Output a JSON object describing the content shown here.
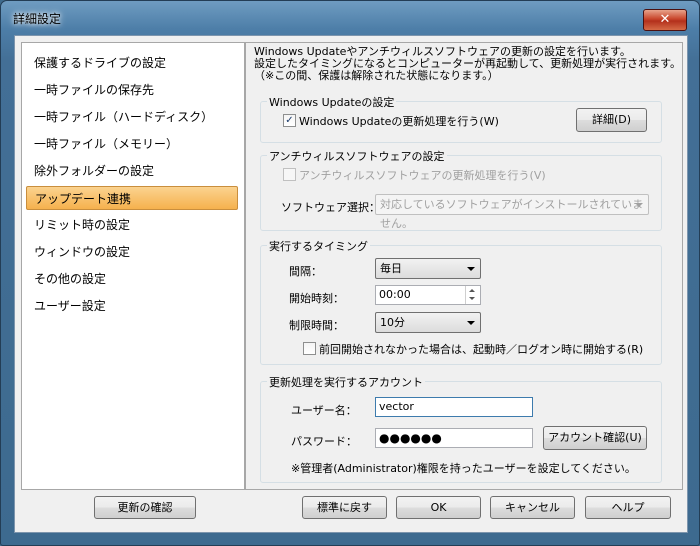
{
  "window": {
    "title": "詳細設定",
    "close_glyph": "✕"
  },
  "sidebar": {
    "items": [
      {
        "label": "保護するドライブの設定"
      },
      {
        "label": "一時ファイルの保存先"
      },
      {
        "label": "一時ファイル（ハードディスク）"
      },
      {
        "label": "一時ファイル（メモリー）"
      },
      {
        "label": "除外フォルダーの設定"
      },
      {
        "label": "アップデート連携",
        "selected": true
      },
      {
        "label": "リミット時の設定"
      },
      {
        "label": "ウィンドウの設定"
      },
      {
        "label": "その他の設定"
      },
      {
        "label": "ユーザー設定"
      }
    ]
  },
  "main": {
    "description": [
      "Windows Updateやアンチウィルスソフトウェアの更新の設定を行います。",
      "設定したタイミングになるとコンピューターが再起動して、更新処理が実行されます。",
      "（※この間、保護は解除された状態になります。）"
    ],
    "windows_update": {
      "group_label": "Windows Updateの設定",
      "checkbox_label": "Windows Updateの更新処理を行う(W)",
      "checked": true,
      "check_glyph": "✓",
      "details_button": "詳細(D)"
    },
    "antivirus": {
      "group_label": "アンチウィルスソフトウェアの設定",
      "checkbox_label": "アンチウィルスソフトウェアの更新処理を行う(V)",
      "checked": false,
      "software_label": "ソフトウェア選択：",
      "software_value": "対応しているソフトウェアがインストールされていません。"
    },
    "timing": {
      "group_label": "実行するタイミング",
      "interval_label": "間隔：",
      "interval_value": "毎日",
      "start_label": "開始時刻：",
      "start_value": "00:00",
      "limit_label": "制限時間：",
      "limit_value": "10分",
      "retry_label": "前回開始されなかった場合は、起動時／ログオン時に開始する(R)",
      "retry_checked": false
    },
    "account": {
      "group_label": "更新処理を実行するアカウント",
      "username_label": "ユーザー名：",
      "username_value": "vector",
      "password_label": "パスワード：",
      "password_value": "●●●●●●",
      "confirm_button": "アカウント確認(U)",
      "note": "※管理者(Administrator)権限を持ったユーザーを設定してください。"
    }
  },
  "footer": {
    "check_updates": "更新の確認",
    "reset": "標準に戻す",
    "ok": "OK",
    "cancel": "キャンセル",
    "help": "ヘルプ"
  },
  "colors": {
    "selection": "#f5b14d",
    "frame": "#4d7ea8",
    "close": "#c8452a"
  }
}
